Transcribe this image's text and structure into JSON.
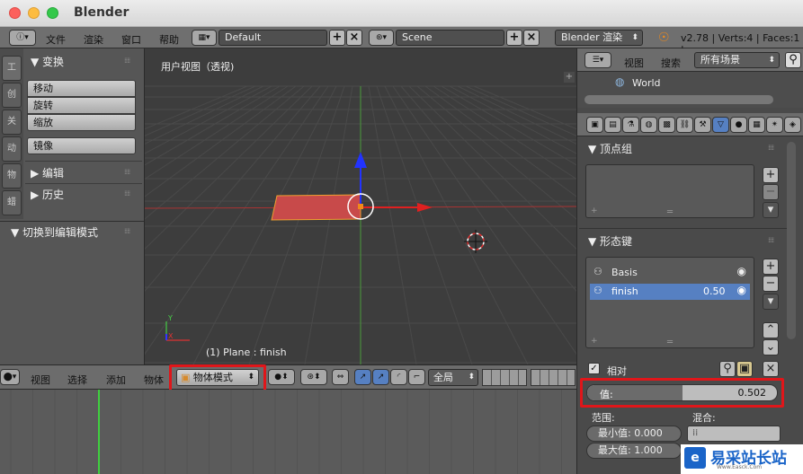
{
  "window": {
    "title": "Blender"
  },
  "topbar": {
    "menus": [
      "文件",
      "渲染",
      "窗口",
      "帮助"
    ],
    "layout": "Default",
    "scene": "Scene",
    "engine": "Blender 渲染",
    "stats": "v2.78 | Verts:4 | Faces:1 |"
  },
  "tools": {
    "tabs": [
      "工",
      "创",
      "关",
      "动",
      "物",
      "蜡"
    ],
    "transform_header": "▼ 变换",
    "move": "移动",
    "rotate": "旋转",
    "scale": "缩放",
    "mirror": "镜像",
    "edit_header": "▶ 编辑",
    "history_header": "▶ 历史",
    "toggle_edit_header": "▼ 切换到编辑模式"
  },
  "viewport": {
    "title": "用户视图（透视)",
    "object_info": "(1) Plane : finish"
  },
  "bottombar": {
    "menus": [
      "视图",
      "选择",
      "添加",
      "物体"
    ],
    "mode": "物体模式",
    "orientation": "全局"
  },
  "outliner": {
    "view_menu": "视图",
    "search_menu": "搜索",
    "filter": "所有场景",
    "world_item": "World"
  },
  "properties": {
    "vertex_groups_header": "▼ 顶点组",
    "shape_keys_header": "▼ 形态键",
    "shape_keys": [
      {
        "name": "Basis",
        "value": ""
      },
      {
        "name": "finish",
        "value": "0.50"
      }
    ],
    "relative_label": "相对",
    "value_label": "值:",
    "value": "0.502",
    "value_fraction": 0.502,
    "range_label": "范围:",
    "blend_label": "混合:",
    "min_label": "最小值: 0.000",
    "max_label": "最大值: 1.000"
  },
  "watermark": {
    "text": "易采站长站",
    "sub": "Www.Easck.Com"
  },
  "colors": {
    "accent_blue": "#5680c2",
    "highlight_red": "#e0161a",
    "plane_red": "#c84a4a"
  }
}
